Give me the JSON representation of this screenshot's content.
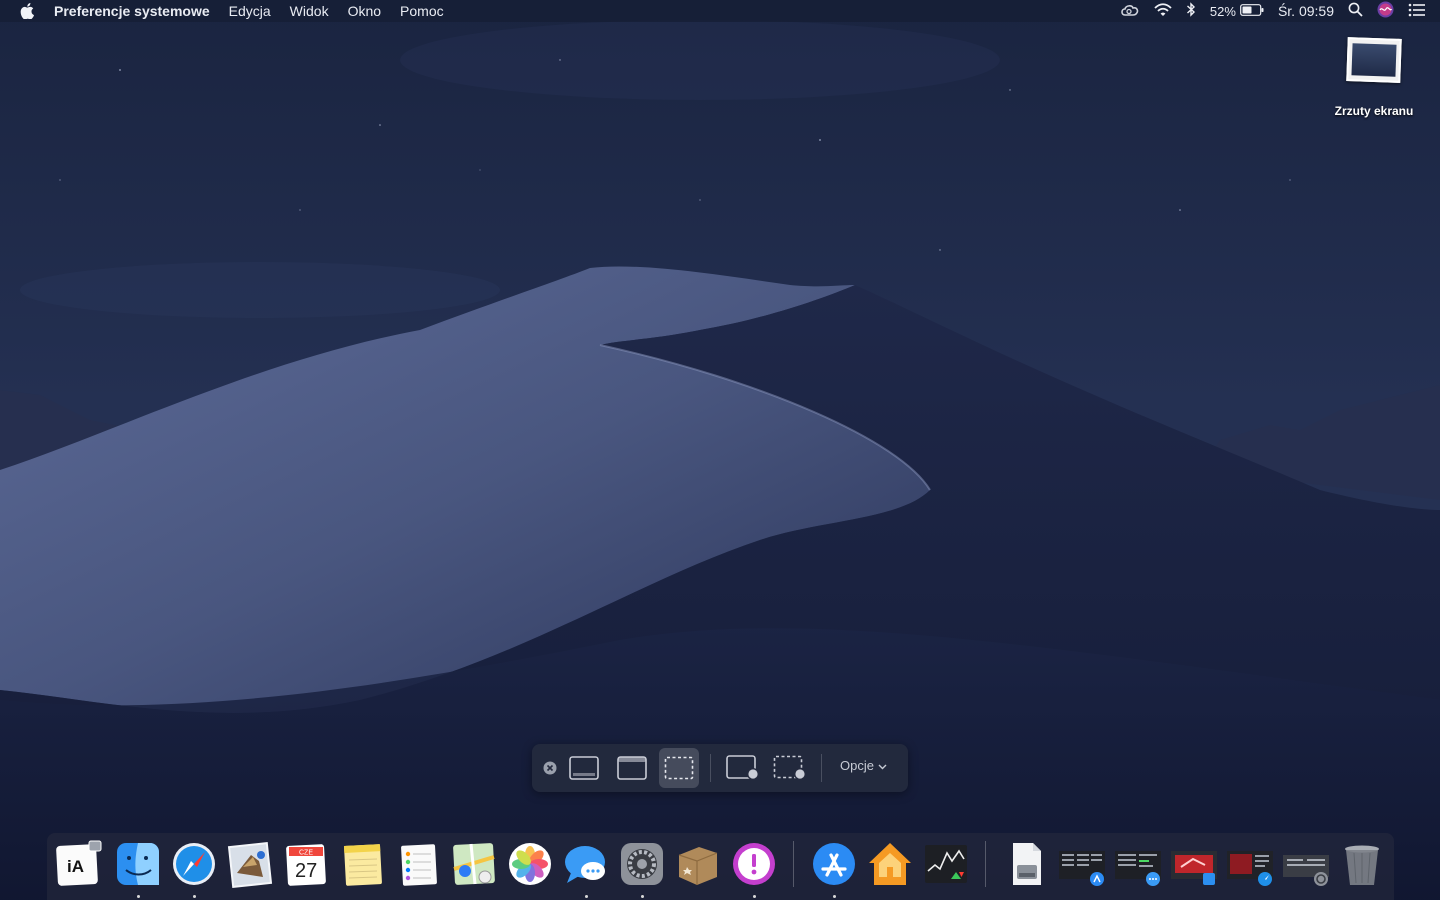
{
  "menubar": {
    "app_name": "Preferencje systemowe",
    "menus": [
      "Edycja",
      "Widok",
      "Okno",
      "Pomoc"
    ],
    "battery_percent": "52%",
    "clock": "Śr. 09:59",
    "status_icons": [
      "creative-cloud-icon",
      "wifi-icon",
      "bluetooth-icon",
      "battery-icon",
      "spotlight-search-icon",
      "siri-icon",
      "notification-center-icon"
    ]
  },
  "desktop": {
    "icons": [
      {
        "label": "Zrzuty ekranu",
        "icon": "screenshot-folder-icon"
      }
    ]
  },
  "screenshot_toolbar": {
    "options_label": "Opcje",
    "buttons": [
      "close",
      "capture-entire-screen",
      "capture-window",
      "capture-selection",
      "record-entire-screen",
      "record-selection"
    ],
    "selected": "capture-selection"
  },
  "dock": {
    "items": [
      {
        "name": "ia-writer",
        "running": false
      },
      {
        "name": "finder",
        "running": true
      },
      {
        "name": "safari",
        "running": true
      },
      {
        "name": "mail",
        "running": false
      },
      {
        "name": "calendar",
        "running": false,
        "month": "CZE",
        "day": "27"
      },
      {
        "name": "notes",
        "running": false
      },
      {
        "name": "reminders",
        "running": false
      },
      {
        "name": "maps",
        "running": false
      },
      {
        "name": "photos",
        "running": false
      },
      {
        "name": "messages",
        "running": true
      },
      {
        "name": "system-preferences",
        "running": true
      },
      {
        "name": "deliveries",
        "running": false
      },
      {
        "name": "omnifocus",
        "running": true
      },
      {
        "name": "app-store",
        "running": true
      },
      {
        "name": "home",
        "running": false
      },
      {
        "name": "stocks",
        "running": false
      },
      {
        "name": "disk-utility",
        "running": false
      },
      {
        "name": "minimized-window-1",
        "running": false
      },
      {
        "name": "minimized-window-2",
        "running": false
      },
      {
        "name": "minimized-window-3",
        "running": false
      },
      {
        "name": "minimized-window-4",
        "running": false
      },
      {
        "name": "minimized-window-5",
        "running": false
      },
      {
        "name": "trash",
        "running": false
      }
    ]
  }
}
